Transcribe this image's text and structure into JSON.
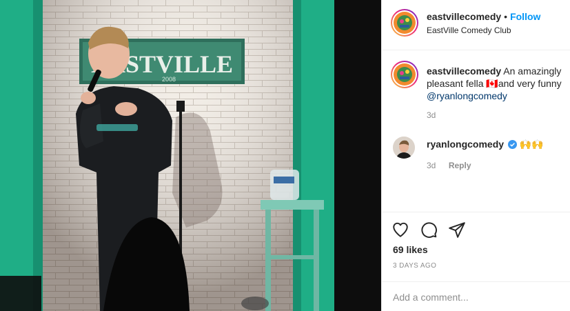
{
  "post": {
    "author": "eastvillecomedy",
    "follow_label": "Follow",
    "separator": "•",
    "location": "EastVille Comedy Club",
    "photo_sign_text": "EASTVILLE",
    "photo_sign_year": "2008"
  },
  "caption": {
    "author": "eastvillecomedy",
    "text": "An amazingly pleasant fella ",
    "flag": "🇨🇦",
    "text2": "and very funny",
    "mention": "@ryanlongcomedy",
    "time": "3d"
  },
  "comment": {
    "author": "ryanlongcomedy",
    "verified": true,
    "text": "🙌🙌",
    "time": "3d",
    "reply_label": "Reply"
  },
  "actions": {
    "likes": "69 likes",
    "posted": "3 DAYS AGO"
  },
  "comment_box": {
    "placeholder": "Add a comment..."
  },
  "colors": {
    "accent": "#0095f6",
    "verified": "#3897f0",
    "mention": "#00376b",
    "wall_teal": "#1fae86"
  },
  "icons": [
    "heart-icon",
    "comment-icon",
    "share-icon",
    "verified-badge-icon"
  ]
}
